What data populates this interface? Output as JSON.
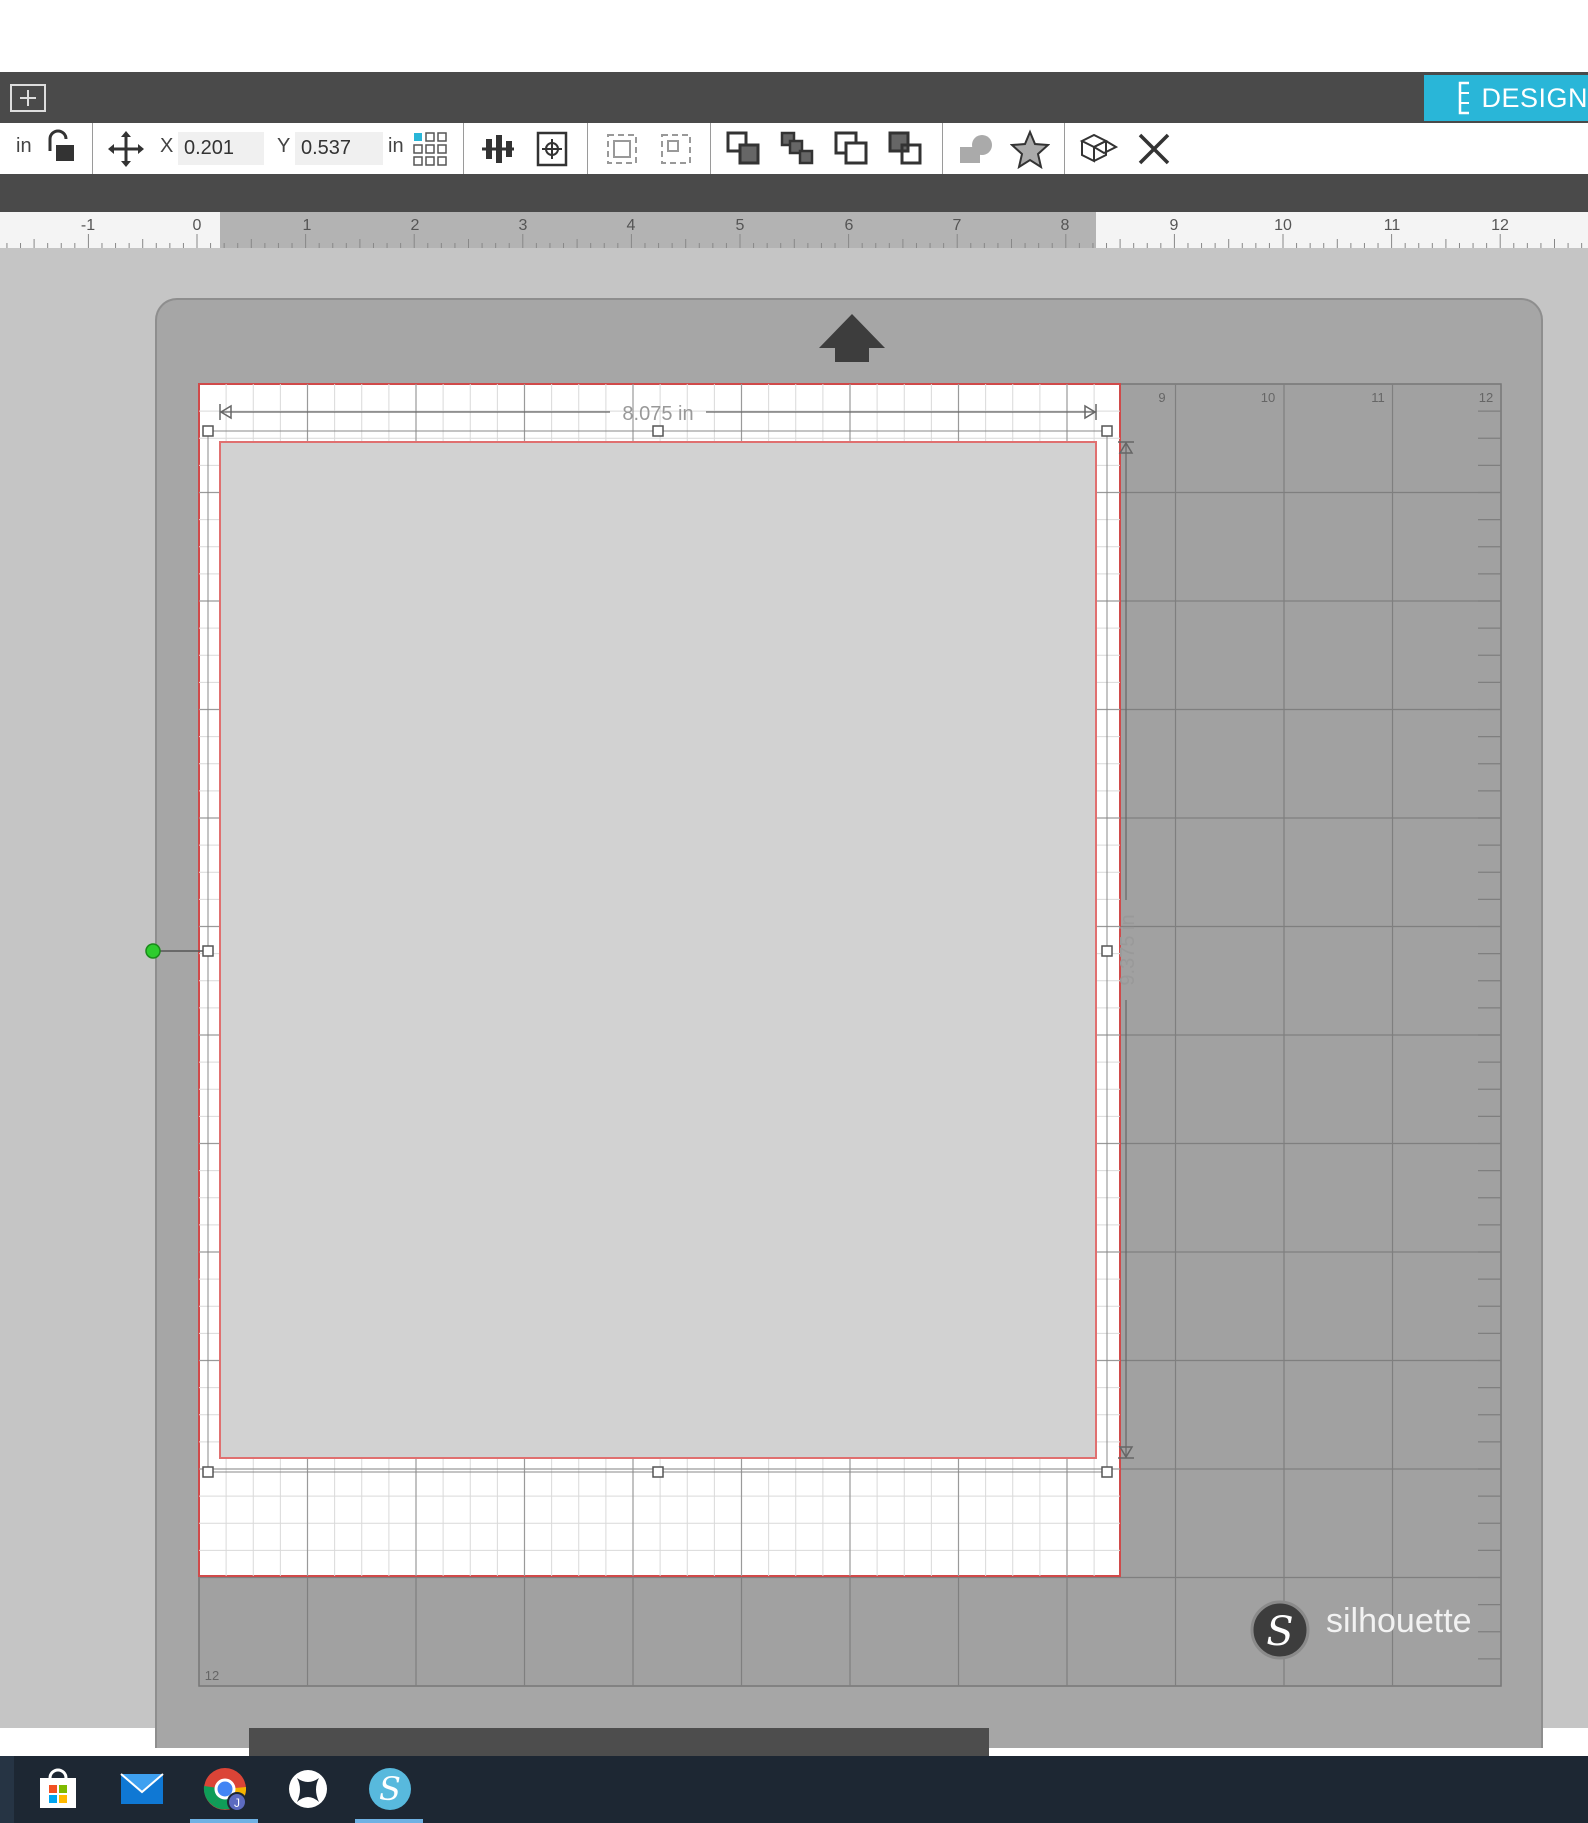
{
  "header": {
    "design_tab_label": "DESIGN"
  },
  "toolbar": {
    "unit_left": "in",
    "x_label": "X",
    "x_value": "0.201",
    "y_label": "Y",
    "y_value": "0.537",
    "unit_right": "in"
  },
  "ruler": {
    "labels": [
      "-1",
      "0",
      "1",
      "2",
      "3",
      "4",
      "5",
      "6",
      "7",
      "8",
      "9",
      "10",
      "11",
      "12"
    ]
  },
  "mat": {
    "column_labels": [
      "9",
      "10",
      "11",
      "12"
    ],
    "corner_label": "12",
    "brand": "silhouette"
  },
  "selection": {
    "width_label": "8.075 in",
    "height_label": "9.375 in"
  },
  "taskbar": {
    "apps": [
      "store-icon",
      "mail-icon",
      "chrome-icon",
      "xbox-icon",
      "silhouette-studio-icon"
    ]
  },
  "colors": {
    "accent": "#29b6d8",
    "dark_bar": "#4a4a4a",
    "mat": "#a6a6a6",
    "cut_line": "#e05050",
    "handle_rotate": "#2ecc2e"
  }
}
